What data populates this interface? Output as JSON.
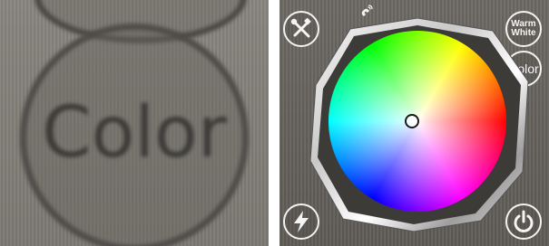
{
  "zoom_panel": {
    "label": "Color"
  },
  "app": {
    "buttons": {
      "settings_icon": "wrench-screwdriver-icon",
      "warm_white_line1": "Warm",
      "warm_white_line2": "White",
      "color_label": "Color",
      "flash_icon": "lightning-bolt-icon",
      "power_icon": "power-icon"
    },
    "status": {
      "connection_icon": "phone-signal-icon"
    },
    "color_wheel": {
      "icon": "color-wheel",
      "selected_color": "#ffffff"
    }
  }
}
